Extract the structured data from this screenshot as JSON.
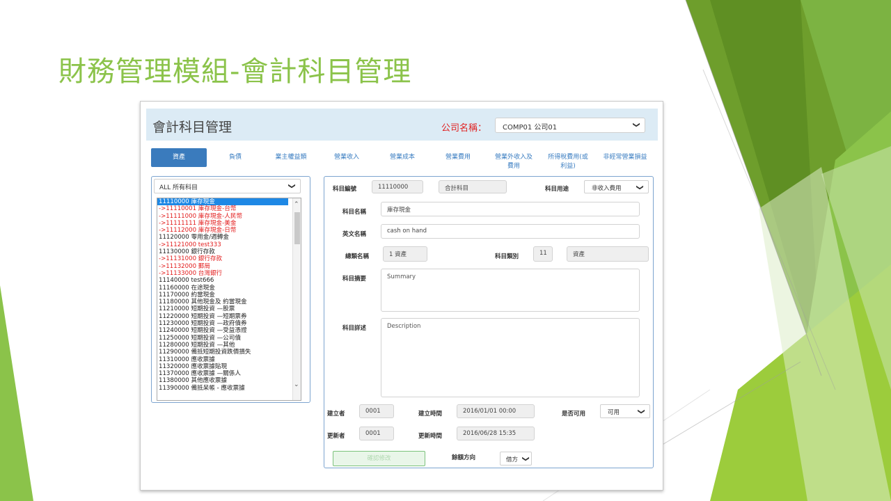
{
  "slide_title": "財務管理模組-會計科目管理",
  "window": {
    "title": "會計科目管理",
    "company_label": "公司名稱：",
    "company_value": "COMP01 公司01"
  },
  "tabs": [
    {
      "label": "資產",
      "active": true
    },
    {
      "label": "負債"
    },
    {
      "label": "業主權益類"
    },
    {
      "label": "營業收入"
    },
    {
      "label": "營業成本"
    },
    {
      "label": "營業費用"
    },
    {
      "label": "營業外收入及費用"
    },
    {
      "label": "所得稅費用(或利益)"
    },
    {
      "label": "非經常營業損益"
    }
  ],
  "left_panel": {
    "filter_value": "ALL 所有科目",
    "items": [
      {
        "text": "11110000 庫存現金",
        "style": "sel"
      },
      {
        "text": "->11110001 庫存現金-台幣",
        "style": "red"
      },
      {
        "text": "->11111000 庫存現金-人民幣",
        "style": "red"
      },
      {
        "text": "->11111111 庫存現金-美金",
        "style": "red"
      },
      {
        "text": "->11112000 庫存現金-日幣",
        "style": "red"
      },
      {
        "text": "11120000 零用金/週轉金",
        "style": "normal"
      },
      {
        "text": "->11121000 test333",
        "style": "red"
      },
      {
        "text": "11130000 銀行存款",
        "style": "normal"
      },
      {
        "text": "->11131000 銀行存款",
        "style": "red"
      },
      {
        "text": "->11132000 郵局",
        "style": "red"
      },
      {
        "text": "->11133000 台灣銀行",
        "style": "red"
      },
      {
        "text": "11140000 test666",
        "style": "normal"
      },
      {
        "text": "11160000 在途現金",
        "style": "normal"
      },
      {
        "text": "11170000 約當現金",
        "style": "normal"
      },
      {
        "text": "11180000 其他現金及 約當現金",
        "style": "normal"
      },
      {
        "text": "11210000 短期投資 —股票",
        "style": "normal"
      },
      {
        "text": "11220000 短期投資 —短期票券",
        "style": "normal"
      },
      {
        "text": "11230000 短期投資 —政府債券",
        "style": "normal"
      },
      {
        "text": "11240000 短期投資 —受益憑證",
        "style": "normal"
      },
      {
        "text": "11250000 短期投資 —公司債",
        "style": "normal"
      },
      {
        "text": "11280000 短期投資 —其他",
        "style": "normal"
      },
      {
        "text": "11290000 備抵短期投資跌價損失",
        "style": "normal"
      },
      {
        "text": "11310000 應收票據",
        "style": "normal"
      },
      {
        "text": "11320000 應收票據貼現",
        "style": "normal"
      },
      {
        "text": "11370000 應收票據 —關係人",
        "style": "normal"
      },
      {
        "text": "11380000 其他應收票據",
        "style": "normal"
      },
      {
        "text": "11390000 備抵呆帳 - 應收票據",
        "style": "normal"
      }
    ]
  },
  "form": {
    "code_label": "科目編號",
    "code_value": "11110000",
    "type_value": "合計科目",
    "usage_label": "科目用途",
    "usage_value": "非收入費用",
    "name_label": "科目名稱",
    "name_value": "庫存現金",
    "en_label": "英文名稱",
    "en_value": "cash on hand",
    "category_label": "總類名稱",
    "category_value": "1 資產",
    "class_label": "科目類別",
    "class_code": "11",
    "class_name": "資產",
    "summary_label": "科目摘要",
    "summary_placeholder": "Summary",
    "detail_label": "科目詳述",
    "detail_placeholder": "Description",
    "creator_label": "建立者",
    "creator_value": "0001",
    "created_label": "建立時間",
    "created_value": "2016/01/01 00:00",
    "enabled_label": "是否可用",
    "enabled_value": "可用",
    "updater_label": "更新者",
    "updater_value": "0001",
    "updated_label": "更新時間",
    "updated_value": "2016/06/28 15:35",
    "confirm_label": "確認修改",
    "balance_label": "餘額方向",
    "balance_value": "借方"
  }
}
